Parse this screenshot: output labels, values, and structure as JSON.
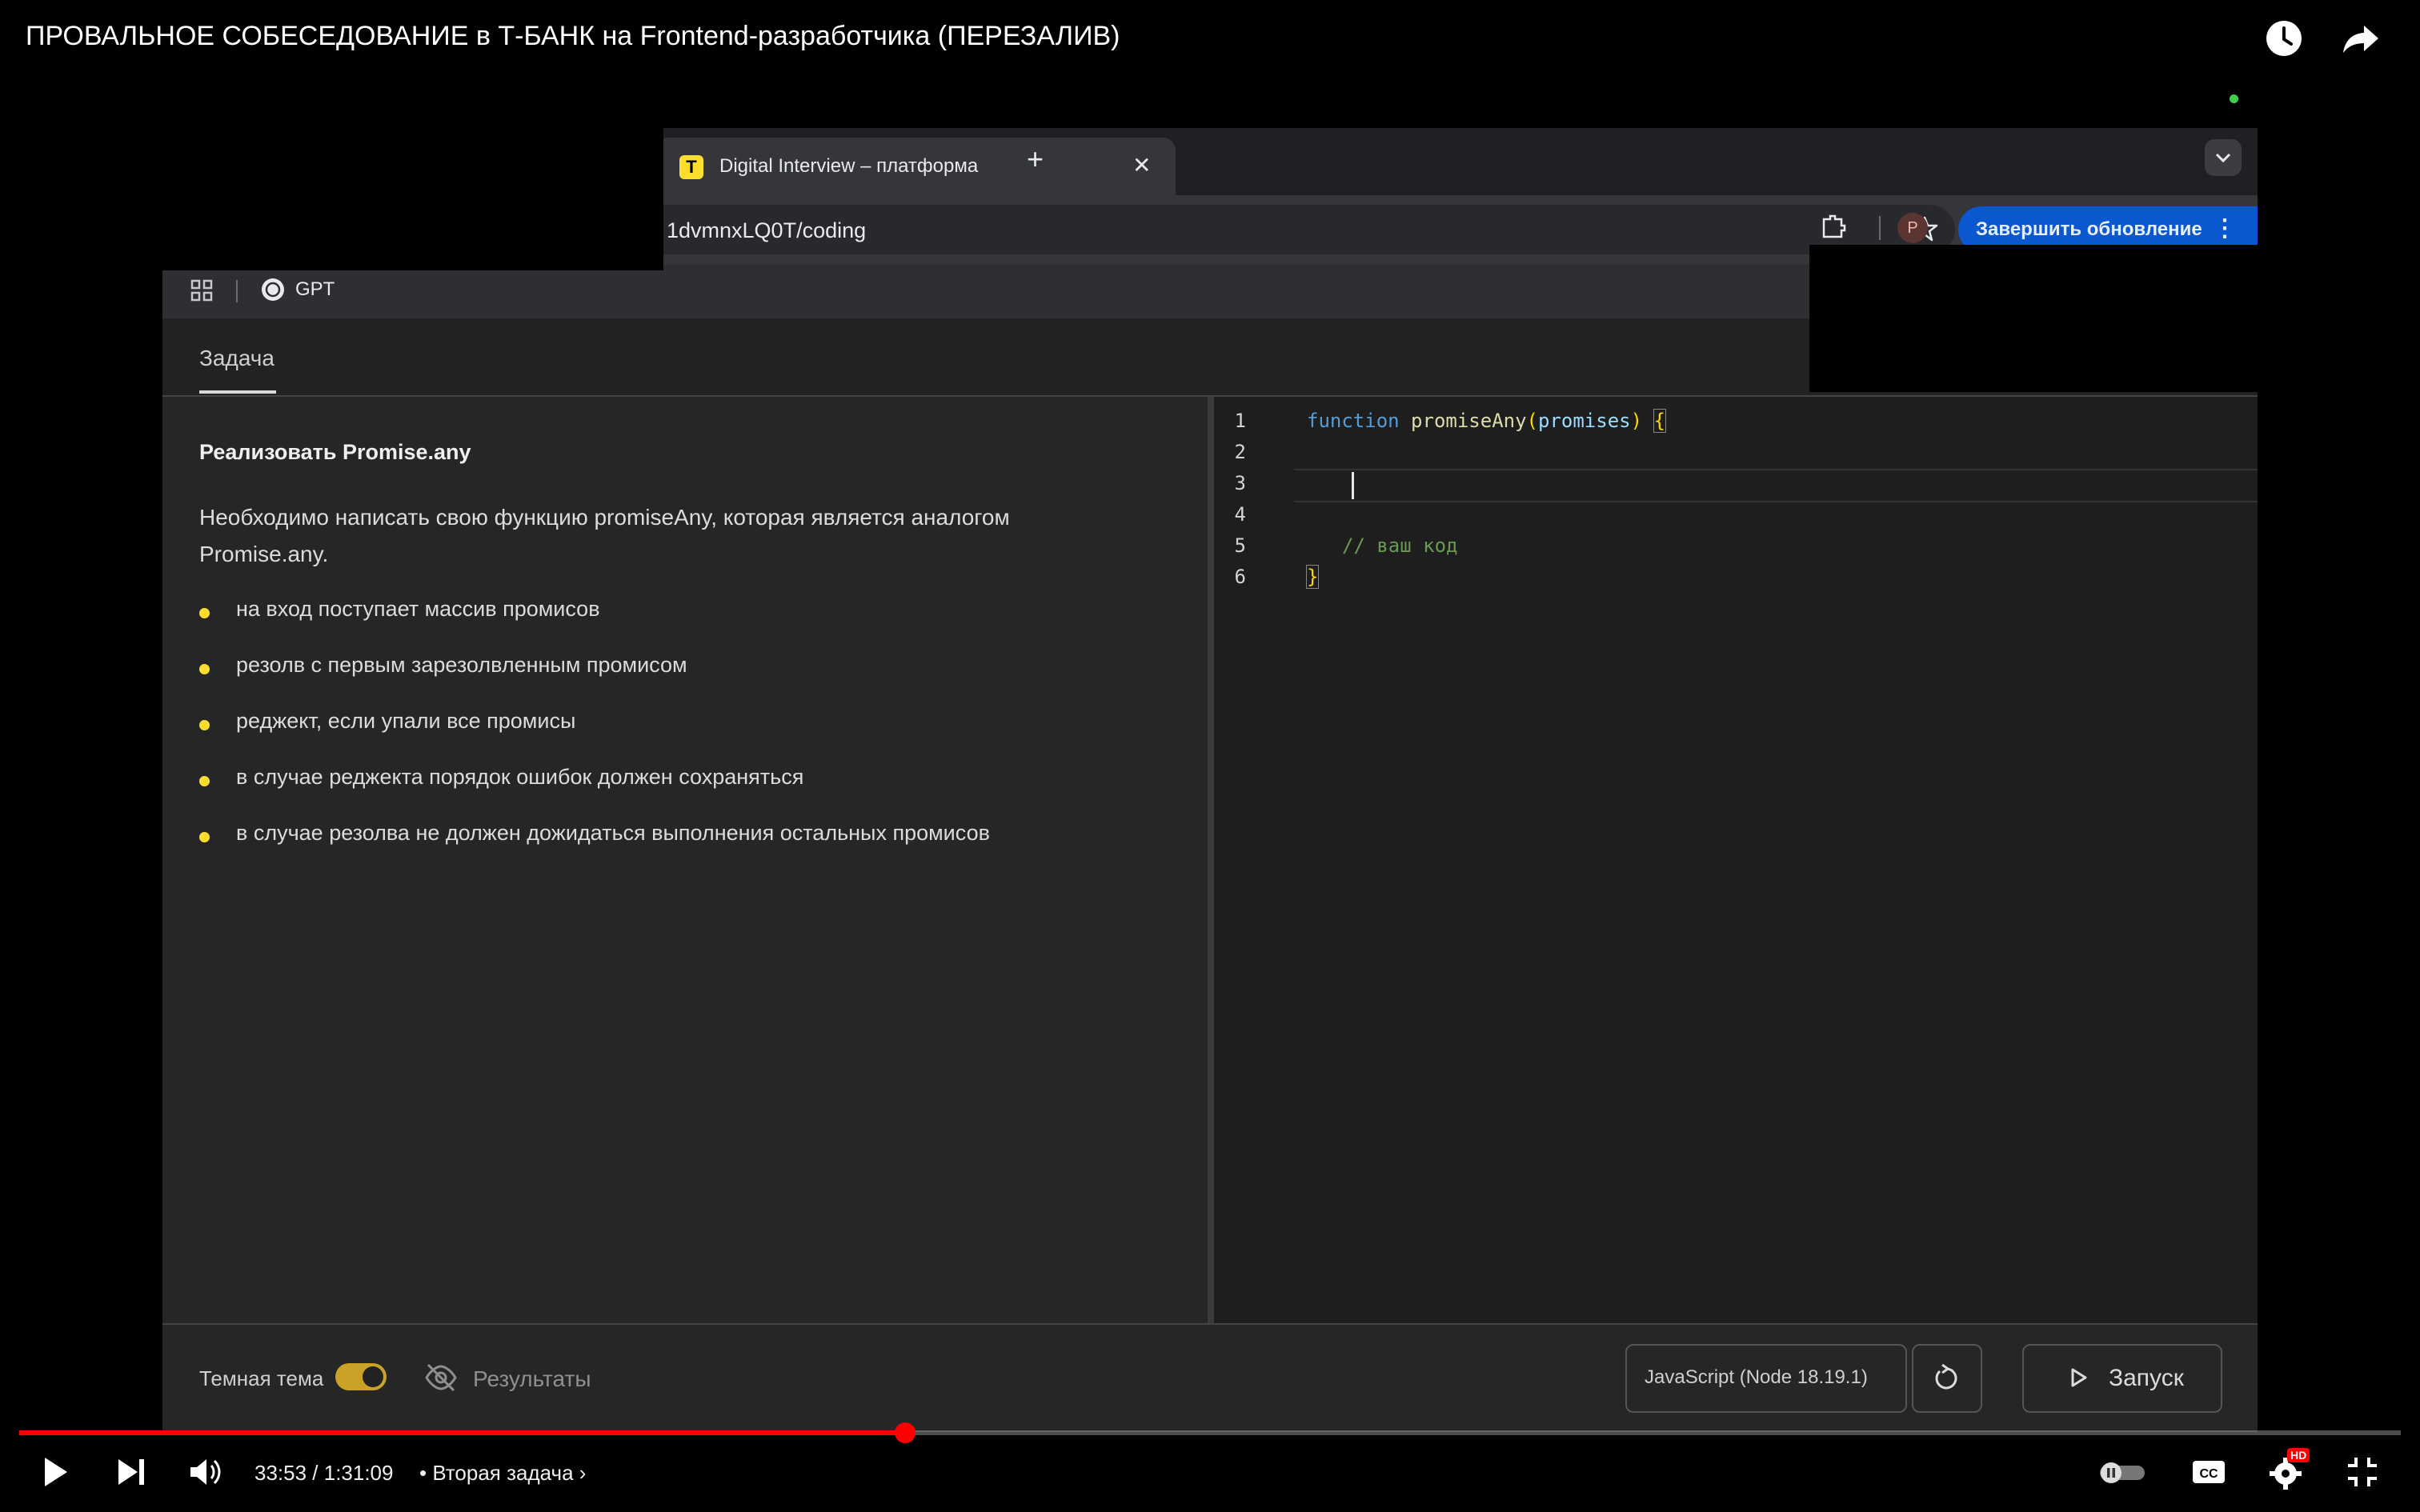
{
  "player": {
    "title": "ПРОВАЛЬНОЕ СОБЕСЕДОВАНИЕ в Т-БАНК на Frontend-разработчика (ПЕРЕЗАЛИВ)",
    "time_current": "33:53",
    "time_total": "1:31:09",
    "time_label": "33:53 / 1:31:09",
    "chapter": "• Вторая задача",
    "progress_fraction": 0.372,
    "hd_badge": "HD",
    "accent_color": "#ff0000"
  },
  "browser": {
    "tab_title": "Digital Interview – платформа",
    "tab_favicon_letter": "T",
    "url": "1dvmnxLQ0T/coding",
    "avatar_letter": "P",
    "update_button": "Завершить обновление",
    "bookmark_gpt": "GPT"
  },
  "app": {
    "tab_task": "Задача",
    "task_title": "Реализовать Promise.any",
    "task_description": "Необходимо написать свою функцию promiseAny, которая является аналогом Promise.any.",
    "requirements": [
      "на вход поступает массив промисов",
      "резолв с первым зарезолвленным промисом",
      "реджект, если упали все промисы",
      "в случае реджекта порядок ошибок должен сохраняться",
      "в случае резолва не должен дожидаться выполнения остальных промисов"
    ],
    "code": {
      "line_numbers": [
        "1",
        "2",
        "3",
        "4",
        "5",
        "6"
      ],
      "kw_function": "function",
      "fn_name": "promiseAny",
      "paren_open": "(",
      "param": "promises",
      "paren_close": ")",
      "brace_open": "{",
      "comment": "// ваш код",
      "brace_close": "}"
    },
    "bottom": {
      "theme_label": "Темная тема",
      "theme_on": true,
      "results_label": "Результаты",
      "language": "JavaScript (Node 18.19.1)",
      "run_label": "Запуск"
    }
  }
}
